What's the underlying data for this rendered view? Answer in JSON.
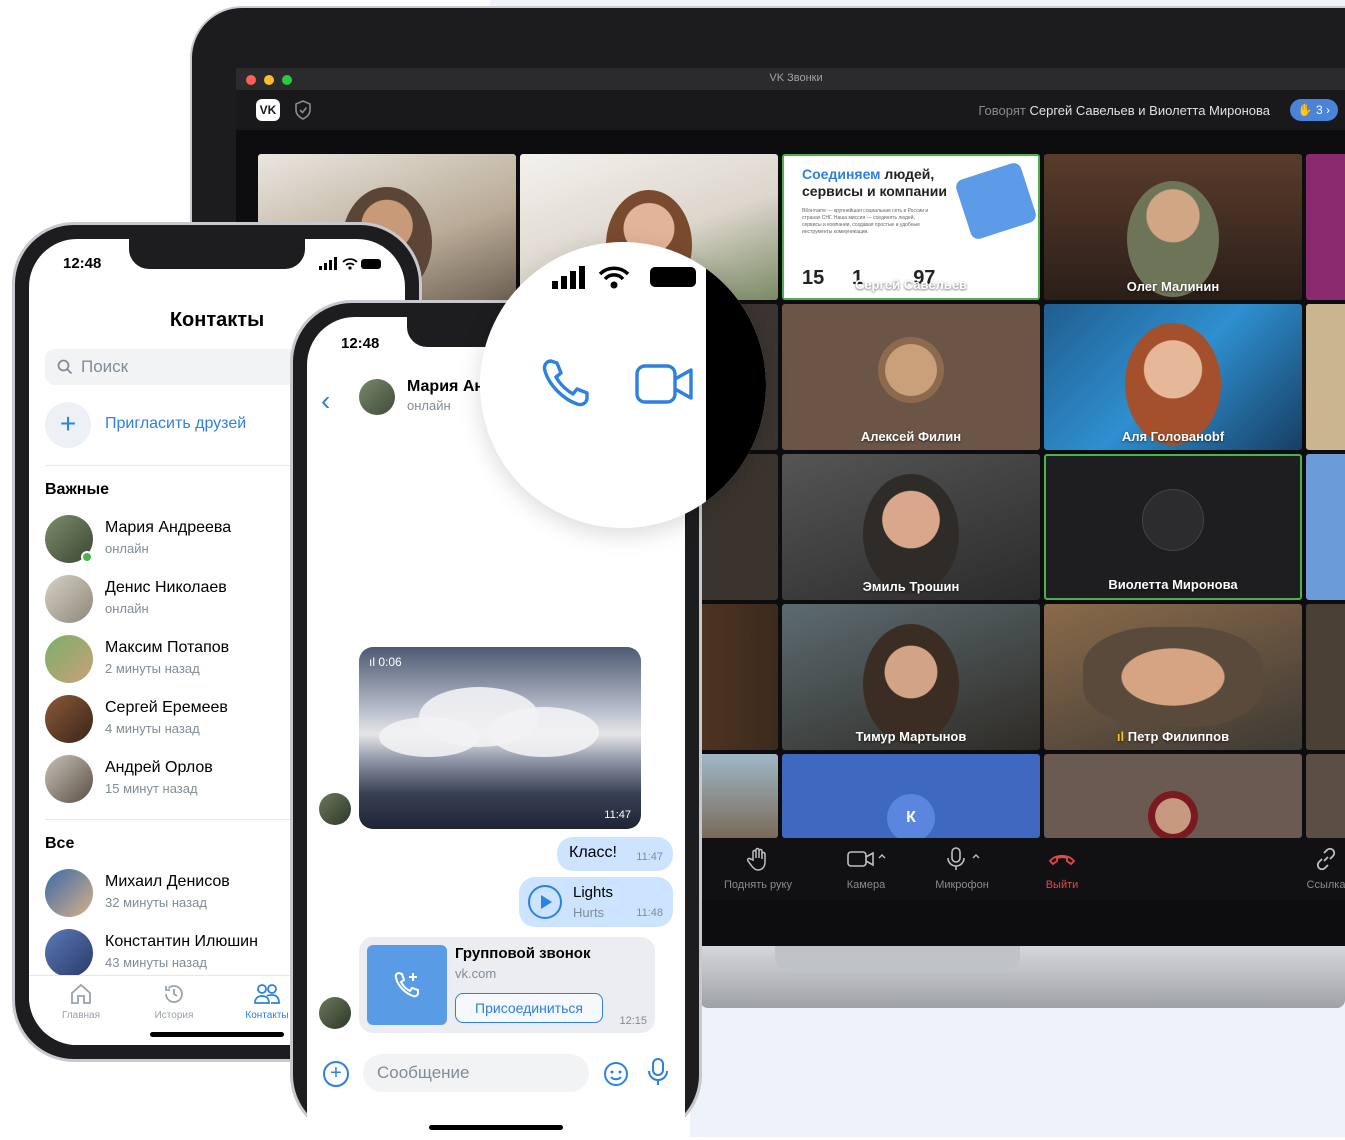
{
  "laptop": {
    "window_title": "VK Звонки",
    "speaking_prefix": "Говорят",
    "speaking_names": "Сергей Савельев и Виолетта Миронова",
    "participants_count": "3",
    "tiles": [
      {
        "name": ""
      },
      {
        "name": ""
      },
      {
        "name": "Сергей Савельев"
      },
      {
        "name": "Олег Малинин"
      },
      {
        "name": "Алексей Филин"
      },
      {
        "name": "Аля Голованоbf"
      },
      {
        "name": "Эмиль Трошин"
      },
      {
        "name": "Виолетта Миронова"
      },
      {
        "name": "Тимур Мартынов"
      },
      {
        "name": "Петр Филиппов"
      },
      {
        "name": "К"
      }
    ],
    "promo": {
      "title_highlight": "Соединяем",
      "title_rest": " людей,",
      "title_line2": "сервисы и компании",
      "body": "ВКонтакте — крупнейшая социальная сеть в России и странах СНГ. Наша миссия — соединять людей, сервисы и компании, создавая простые и удобные инструменты коммуникации.",
      "stat1": "15",
      "stat2": "1",
      "stat3": "97"
    },
    "controls": [
      {
        "label": "Поднять руку",
        "icon": "hand-icon"
      },
      {
        "label": "Камера",
        "icon": "camera-icon"
      },
      {
        "label": "Микрофон",
        "icon": "microphone-icon"
      },
      {
        "label": "Выйти",
        "icon": "hang-up-icon"
      },
      {
        "label": "Ссылка",
        "icon": "link-icon"
      }
    ]
  },
  "phone1": {
    "time": "12:48",
    "title": "Контакты",
    "search_placeholder": "Поиск",
    "invite_label": "Пригласить друзей",
    "section_important": "Важные",
    "important": [
      {
        "name": "Мария Андреева",
        "status": "онлайн"
      },
      {
        "name": "Денис Николаев",
        "status": "онлайн"
      },
      {
        "name": "Максим Потапов",
        "status": "2 минуты назад"
      },
      {
        "name": "Сергей Еремеев",
        "status": "4 минуты назад"
      },
      {
        "name": "Андрей Орлов",
        "status": "15 минут назад"
      }
    ],
    "section_all": "Все",
    "all": [
      {
        "name": "Михаил Денисов",
        "status": "32 минуты назад"
      },
      {
        "name": "Константин Илюшин",
        "status": "43 минуты назад"
      }
    ],
    "tabs": [
      {
        "label": "Главная"
      },
      {
        "label": "История"
      },
      {
        "label": "Контакты"
      }
    ]
  },
  "phone2": {
    "time": "12:48",
    "contact_name": "Мария Ан",
    "contact_status": "онлайн",
    "video": {
      "duration": "0:06",
      "time": "11:47"
    },
    "msg1": {
      "text": "Класс!",
      "time": "11:47"
    },
    "audio": {
      "title": "Lights",
      "artist": "Hurts",
      "time": "11:48"
    },
    "call": {
      "title": "Групповой звонок",
      "domain": "vk.com",
      "button": "Присоединиться",
      "time": "12:15"
    },
    "composer_placeholder": "Сообщение"
  },
  "colors": {
    "accent": "#2d81e0",
    "online": "#4bb34b",
    "hangup": "#e64646",
    "bubble": "#cce4ff"
  }
}
